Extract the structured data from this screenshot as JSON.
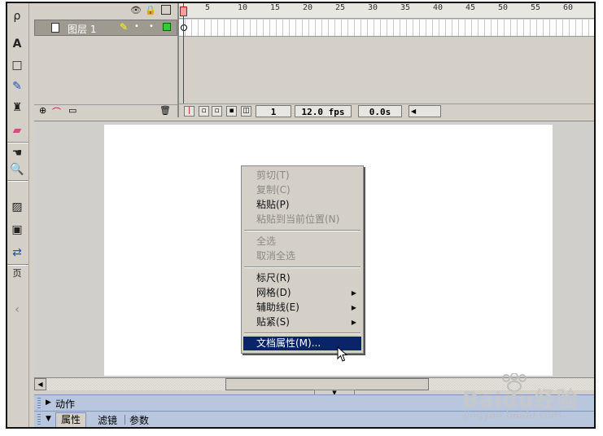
{
  "timeline": {
    "layer_name": "图层 1",
    "ruler_ticks": [
      "5",
      "10",
      "15",
      "20",
      "25",
      "30",
      "35",
      "40",
      "45",
      "50",
      "55",
      "60"
    ],
    "current_frame": "1",
    "frame_rate": "12.0 fps",
    "elapsed_time": "0.0s"
  },
  "context_menu": {
    "items": [
      {
        "label": "剪切(T)",
        "enabled": false
      },
      {
        "label": "复制(C)",
        "enabled": false
      },
      {
        "label": "粘贴(P)",
        "enabled": true
      },
      {
        "label": "粘贴到当前位置(N)",
        "enabled": false
      },
      {
        "label": "全选",
        "enabled": false
      },
      {
        "label": "取消全选",
        "enabled": false
      },
      {
        "label": "标尺(R)",
        "enabled": true
      },
      {
        "label": "网格(D)",
        "enabled": true,
        "submenu": true
      },
      {
        "label": "辅助线(E)",
        "enabled": true,
        "submenu": true
      },
      {
        "label": "贴紧(S)",
        "enabled": true,
        "submenu": true
      },
      {
        "label": "文档属性(M)...",
        "enabled": true,
        "selected": true
      }
    ]
  },
  "panels": {
    "actions_label": "动作",
    "properties_tabs": [
      "属性",
      "滤镜",
      "参数"
    ]
  },
  "watermark": {
    "brand": "Baidu经验",
    "url": "jingyan.baidu.com"
  },
  "colors": {
    "selection": "#0a246a",
    "chrome": "#d4d0c8",
    "panel_header": "#b8c7de",
    "playhead": "#e00000"
  }
}
